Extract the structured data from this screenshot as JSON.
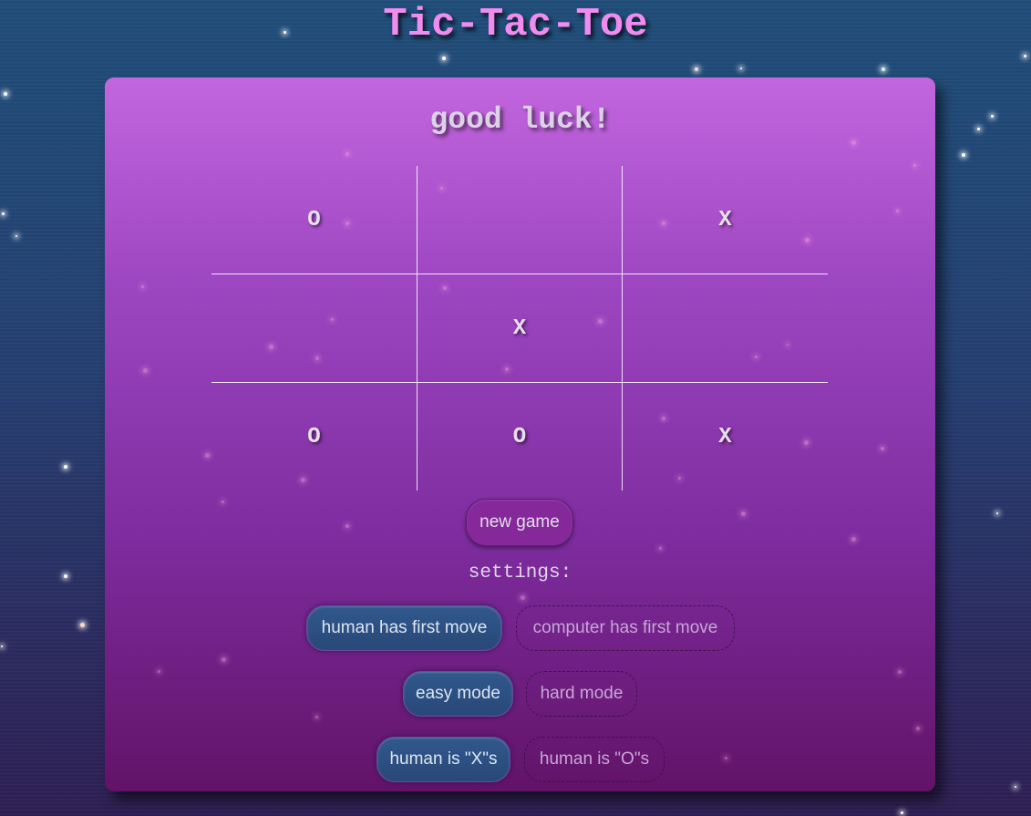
{
  "title": "Tic-Tac-Toe",
  "status": "good luck!",
  "board": [
    [
      "O",
      "",
      "X"
    ],
    [
      "",
      "X",
      ""
    ],
    [
      "O",
      "O",
      "X"
    ]
  ],
  "buttons": {
    "new_game": "new game"
  },
  "settings": {
    "label": "settings:",
    "first_move": {
      "selected": "human has first move",
      "options": [
        "human has first move",
        "computer has first move"
      ]
    },
    "difficulty": {
      "selected": "easy mode",
      "options": [
        "easy mode",
        "hard mode"
      ]
    },
    "symbol": {
      "selected": "human is \"X\"s",
      "options": [
        "human is \"X\"s",
        "human is \"O\"s"
      ]
    }
  },
  "colors": {
    "title": "#f08cf0",
    "active_toggle": "#31588c",
    "panel_top": "#c266de",
    "panel_bottom": "#621367"
  }
}
